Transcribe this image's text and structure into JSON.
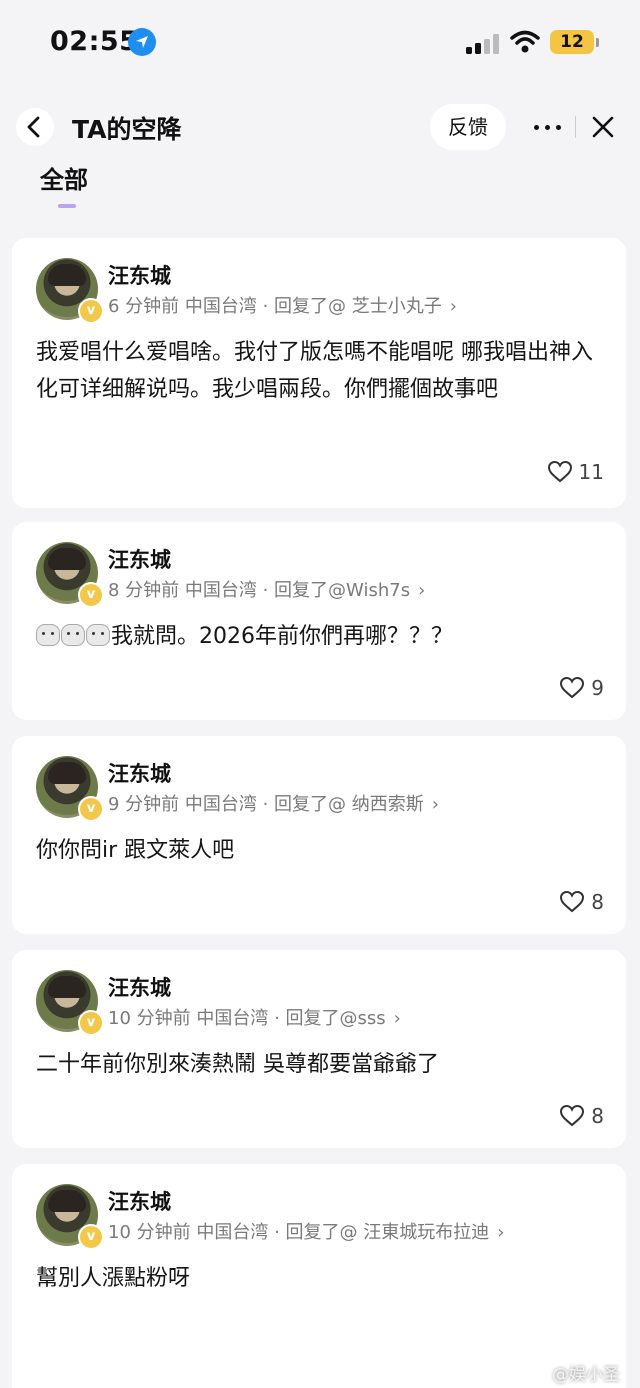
{
  "status_bar": {
    "time": "02:55",
    "battery": "12"
  },
  "header": {
    "title": "TA的空降",
    "feedback_label": "反馈"
  },
  "tabs": [
    {
      "label": "全部",
      "active": true
    }
  ],
  "comments": [
    {
      "author": "汪东城",
      "meta": "6 分钟前  中国台湾 · 回复了@ 芝士小丸子",
      "text": "我爱唱什么爱唱啥。我付了版怎嗎不能唱呢 哪我唱出神入化可详细解说吗。我少唱兩段。你們擺個故事吧",
      "likes": "11"
    },
    {
      "author": "汪东城",
      "meta": "8 分钟前  中国台湾 · 回复了@Wish7s",
      "text": "我就問。2026年前你們再哪？？？",
      "emoji_count": 3,
      "likes": "9"
    },
    {
      "author": "汪东城",
      "meta": "9 分钟前  中国台湾 · 回复了@ 纳西索斯",
      "text": "你你問ir 跟文萊人吧",
      "likes": "8"
    },
    {
      "author": "汪东城",
      "meta": "10 分钟前  中国台湾 · 回复了@sss",
      "text": "二十年前你別來湊熱鬧 吳尊都要當爺爺了",
      "likes": "8"
    },
    {
      "author": "汪东城",
      "meta": "10 分钟前  中国台湾 · 回复了@ 汪東城玩布拉迪",
      "text": "幫別人漲點粉呀",
      "likes": ""
    }
  ],
  "watermark": "@娱小圣",
  "colors": {
    "accent_tab": "#b8a4f0",
    "location_blue": "#1f8ef1",
    "battery_yellow": "#f4c542",
    "verified_badge": "#f3c84a"
  }
}
